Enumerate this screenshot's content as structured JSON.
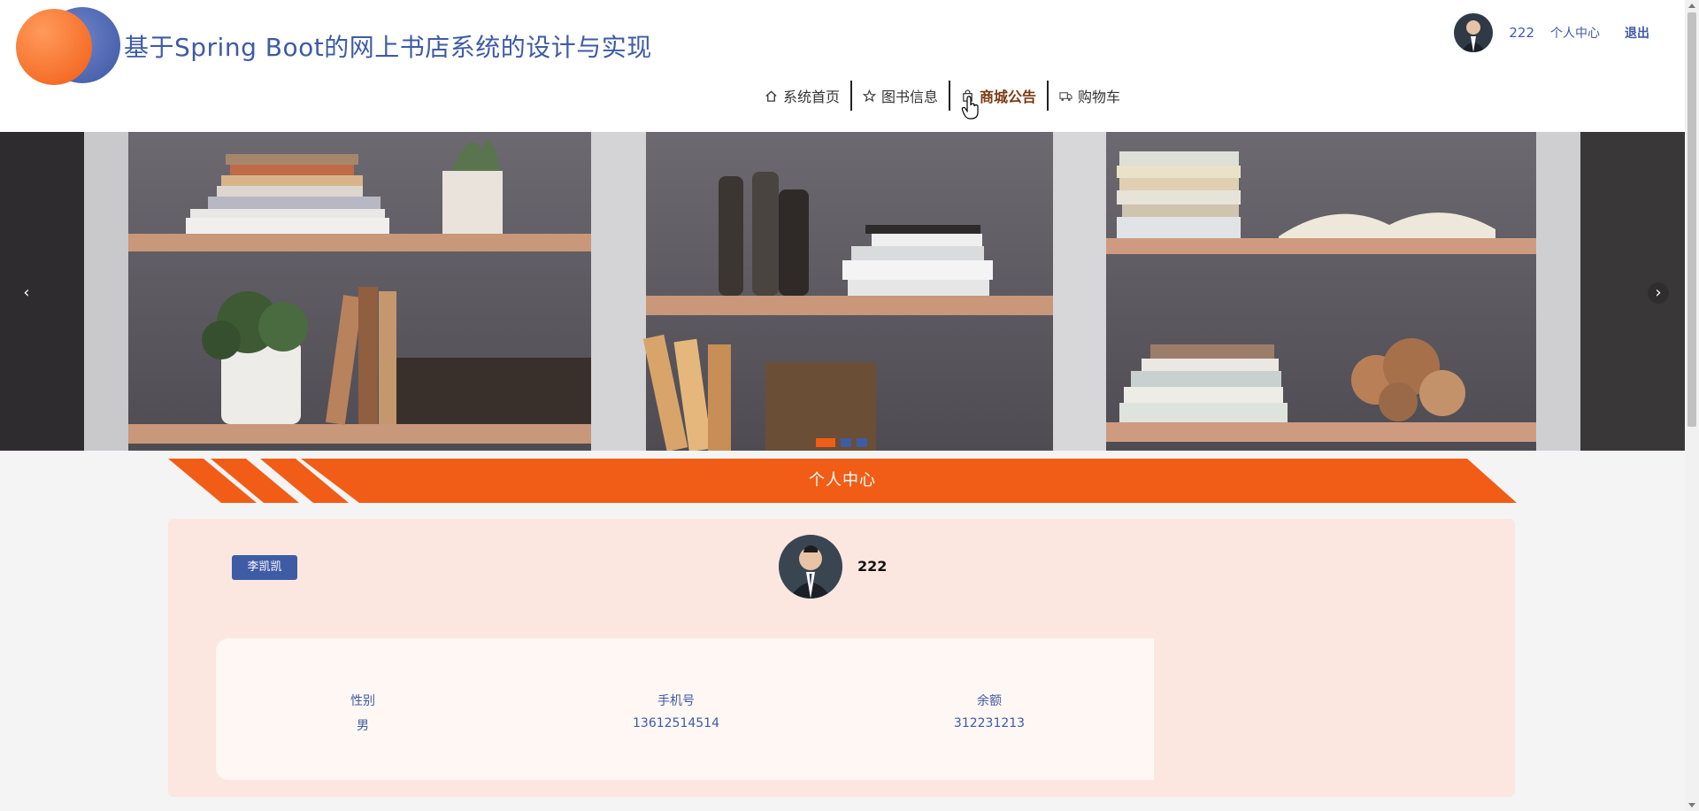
{
  "site": {
    "title": "基于Spring Boot的网上书店系统的设计与实现"
  },
  "user_bar": {
    "username": "222",
    "center_label": "个人中心",
    "logout_label": "退出"
  },
  "nav": {
    "items": [
      {
        "label": "系统首页",
        "icon": "home-icon"
      },
      {
        "label": "图书信息",
        "icon": "star-icon"
      },
      {
        "label": "商城公告",
        "icon": "bag-icon",
        "active": true
      },
      {
        "label": "购物车",
        "icon": "truck-icon"
      }
    ]
  },
  "banner": {
    "prev_label": "‹",
    "next_label": "›",
    "slides": 3,
    "active_slide": 1
  },
  "section": {
    "title": "个人中心"
  },
  "profile": {
    "role_badge": "李凯凯",
    "name": "222",
    "fields": [
      {
        "label": "性别",
        "value": "男"
      },
      {
        "label": "手机号",
        "value": "13612514514"
      },
      {
        "label": "余额",
        "value": "312231213"
      }
    ]
  },
  "colors": {
    "brand_blue": "#3e5ba6",
    "brand_orange": "#f15d16",
    "profile_bg": "#fbe7df"
  }
}
